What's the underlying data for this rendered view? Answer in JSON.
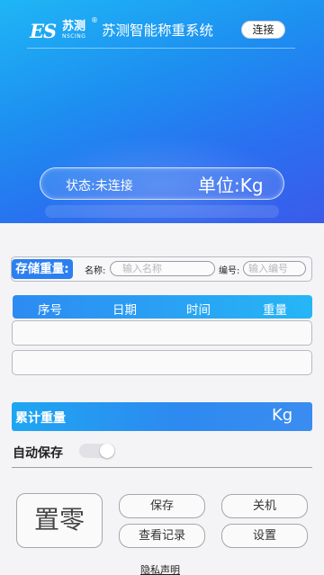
{
  "header": {
    "logo_es": "ES",
    "logo_cn": "苏测",
    "logo_reg": "®",
    "logo_en": "NSCING",
    "app_title": "苏测智能称重系统",
    "connect_label": "连接"
  },
  "status": {
    "state_text": "状态:未连接",
    "unit_text": "单位:Kg"
  },
  "store": {
    "label": "存储重量:",
    "name_label": "名称:",
    "name_placeholder": "输入名称",
    "code_label": "编号:",
    "code_placeholder": "输入编号"
  },
  "table": {
    "columns": [
      "序号",
      "日期",
      "时间",
      "重量"
    ],
    "rows": [
      [
        "",
        "",
        "",
        ""
      ],
      [
        "",
        "",
        "",
        ""
      ]
    ]
  },
  "total": {
    "label": "累计重量",
    "unit": "Kg"
  },
  "autosave": {
    "label": "自动保存",
    "enabled": false
  },
  "buttons": {
    "zero": "置零",
    "save": "保存",
    "power_off": "关机",
    "view_records": "查看记录",
    "settings": "设置"
  },
  "privacy_link": "隐私声明",
  "colors": {
    "header_gradient_start": "#1fb6f5",
    "header_gradient_end": "#3b5bea",
    "accent_blue": "#2b7ff0"
  }
}
